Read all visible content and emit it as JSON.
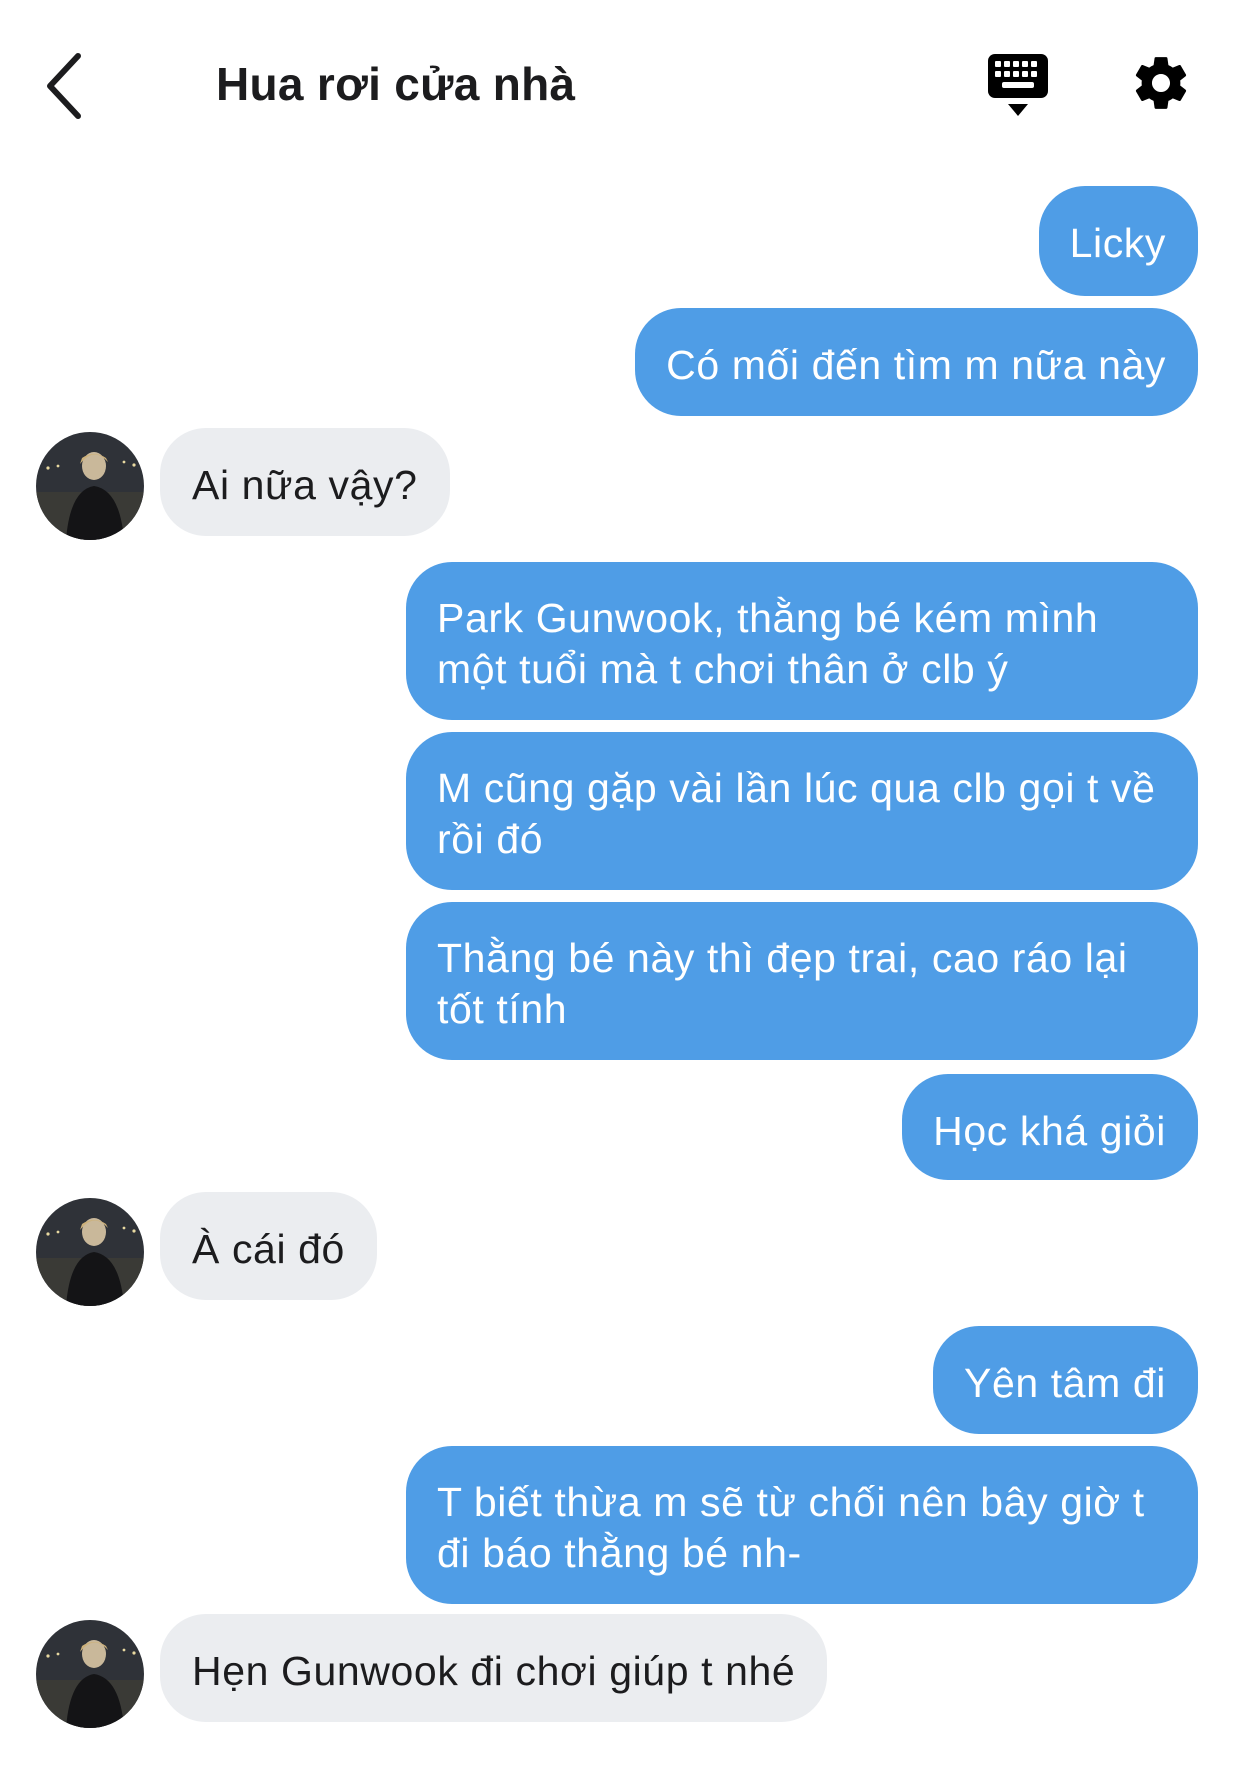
{
  "header": {
    "title": "Hua rơi cửa nhà",
    "back_icon": "chevron-left-icon",
    "keyboard_icon": "keyboard-icon",
    "settings_icon": "gear-icon"
  },
  "colors": {
    "outgoing_bubble": "#4f9de6",
    "incoming_bubble": "#ebedf0",
    "text_dark": "#1c1c1e"
  },
  "messages": [
    {
      "sender": "me",
      "text": "Licky"
    },
    {
      "sender": "me",
      "text": "Có mối đến tìm m nữa này"
    },
    {
      "sender": "other",
      "text": "Ai nữa vậy?"
    },
    {
      "sender": "me",
      "text": "Park Gunwook, thằng bé kém mình một tuổi mà t chơi thân ở clb ý"
    },
    {
      "sender": "me",
      "text": "M cũng gặp vài lần lúc qua clb gọi t về rồi đó"
    },
    {
      "sender": "me",
      "text": "Thằng bé này thì đẹp trai, cao ráo lại tốt tính"
    },
    {
      "sender": "me",
      "text": "Học khá giỏi"
    },
    {
      "sender": "other",
      "text": "À cái đó"
    },
    {
      "sender": "me",
      "text": "Yên tâm đi"
    },
    {
      "sender": "me",
      "text": "T biết thừa m sẽ từ chối nên bây giờ t đi báo thằng bé nh-"
    },
    {
      "sender": "other",
      "text": "Hẹn Gunwook đi chơi giúp t nhé"
    }
  ]
}
